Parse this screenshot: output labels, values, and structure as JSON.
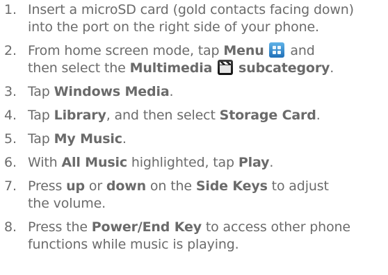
{
  "steps": [
    {
      "num": "1.",
      "t1": "Insert a microSD card (gold contacts facing down)",
      "t2": "into the port on the right side of your phone."
    },
    {
      "num": "2.",
      "a": "From home screen mode, tap ",
      "b1": "Menu",
      "c": " and",
      "d": "then select the ",
      "b2": "Multimedia",
      "b3": "subcategory",
      "e": "."
    },
    {
      "num": "3.",
      "a": "Tap ",
      "b1": "Windows Media",
      "c": "."
    },
    {
      "num": "4.",
      "a": "Tap ",
      "b1": "Library",
      "c": ", and then select ",
      "b2": "Storage Card",
      "d": "."
    },
    {
      "num": "5.",
      "a": "Tap ",
      "b1": "My Music",
      "c": "."
    },
    {
      "num": "6.",
      "a": "With ",
      "b1": "All Music",
      "c": " highlighted, tap ",
      "b2": "Play",
      "d": "."
    },
    {
      "num": "7.",
      "a": "Press ",
      "b1": "up",
      "c": " or ",
      "b2": "down",
      "d": " on the ",
      "b3": "Side Keys",
      "e": " to adjust",
      "f": "the volume."
    },
    {
      "num": "8.",
      "a": "Press the ",
      "b1": "Power/End Key",
      "c": " to access other phone",
      "d": "functions while music is playing."
    }
  ],
  "icons": {
    "menu": "menu-grid-icon",
    "multimedia": "clapperboard-icon",
    "menu_color": "#2a7fcf",
    "multimedia_color": "#1a1a1a"
  }
}
